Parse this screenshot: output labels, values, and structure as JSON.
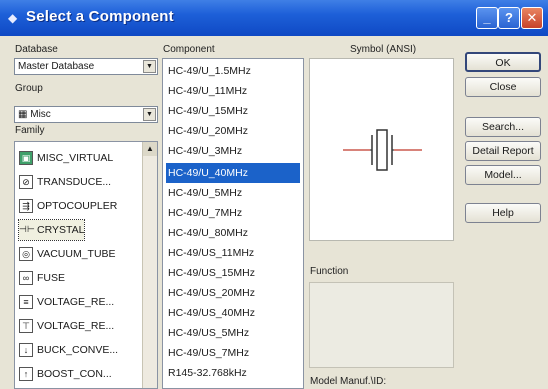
{
  "window": {
    "title": "Select a Component"
  },
  "labels": {
    "database": "Database",
    "group": "Group",
    "family": "Family",
    "component": "Component",
    "symbol": "Symbol (ANSI)",
    "function": "Function",
    "model_manuf": "Model Manuf.\\ID:"
  },
  "database": {
    "value": "Master Database"
  },
  "group": {
    "value": "Misc",
    "icon": "misc-icon"
  },
  "families": [
    {
      "label": "MISC_VIRTUAL",
      "icon": "misc-virtual-icon"
    },
    {
      "label": "TRANSDUCE...",
      "icon": "transducer-icon"
    },
    {
      "label": "OPTOCOUPLER",
      "icon": "optocoupler-icon"
    },
    {
      "label": "CRYSTAL",
      "icon": "crystal-icon"
    },
    {
      "label": "VACUUM_TUBE",
      "icon": "vacuum-tube-icon"
    },
    {
      "label": "FUSE",
      "icon": "fuse-icon"
    },
    {
      "label": "VOLTAGE_RE...",
      "icon": "voltage-regulator-icon"
    },
    {
      "label": "VOLTAGE_RE...",
      "icon": "voltage-reference-icon"
    },
    {
      "label": "BUCK_CONVE...",
      "icon": "buck-converter-icon"
    },
    {
      "label": "BOOST_CON...",
      "icon": "boost-converter-icon"
    }
  ],
  "components": [
    "HC-49/U_1.5MHz",
    "HC-49/U_11MHz",
    "HC-49/U_15MHz",
    "HC-49/U_20MHz",
    "HC-49/U_3MHz",
    "HC-49/U_40MHz",
    "HC-49/U_5MHz",
    "HC-49/U_7MHz",
    "HC-49/U_80MHz",
    "HC-49/US_11MHz",
    "HC-49/US_15MHz",
    "HC-49/US_20MHz",
    "HC-49/US_40MHz",
    "HC-49/US_5MHz",
    "HC-49/US_7MHz",
    "R145-32.768kHz"
  ],
  "selected_component_index": 5,
  "buttons": {
    "ok": "OK",
    "close": "Close",
    "search": "Search...",
    "detail_report": "Detail Report",
    "model": "Model...",
    "help": "Help"
  },
  "colors": {
    "selection": "#1b62c9",
    "titlebar": "#1d5fd8"
  }
}
